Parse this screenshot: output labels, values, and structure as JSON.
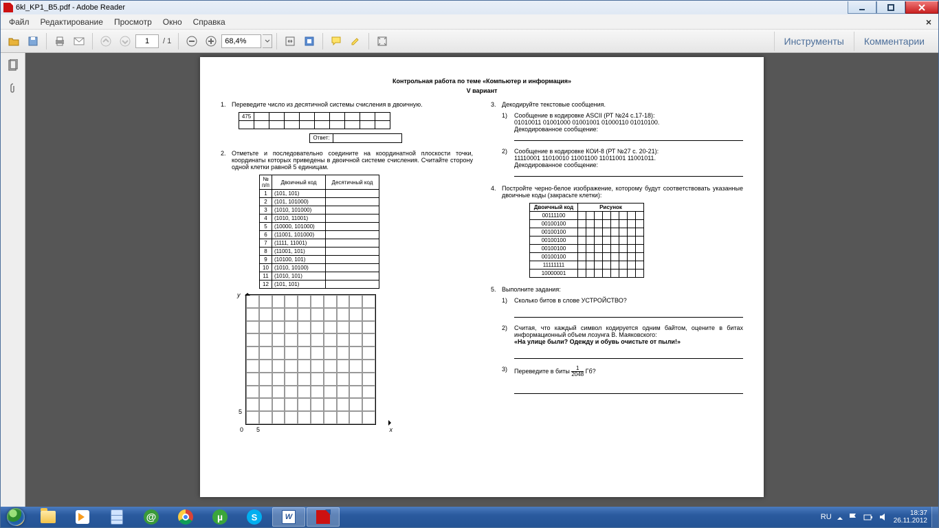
{
  "window": {
    "title": "6kl_KP1_B5.pdf - Adobe Reader"
  },
  "menu": {
    "file": "Файл",
    "edit": "Редактирование",
    "view": "Просмотр",
    "window": "Окно",
    "help": "Справка"
  },
  "toolbar": {
    "page_current": "1",
    "page_total": "/ 1",
    "zoom": "68,4%",
    "tools": "Инструменты",
    "comments": "Комментарии"
  },
  "doc": {
    "title": "Контрольная работа по теме «Компьютер и информация»",
    "subtitle": "V вариант",
    "q1": {
      "num": "1.",
      "text": "Переведите число из десятичной системы счисления в двоичную.",
      "value": "475",
      "answer_label": "Ответ:"
    },
    "q2": {
      "num": "2.",
      "text": "Отметьте и последовательно соедините на координатной плоскости точки, координаты которых приведены в двоичной системе счисления. Считайте сторону одной клетки равной 5 единицам.",
      "head_n": "№ п/п",
      "head_bin": "Двоичный код",
      "head_dec": "Десятичный код",
      "rows": [
        {
          "n": "1",
          "b": "(101, 101)"
        },
        {
          "n": "2",
          "b": "(101, 101000)"
        },
        {
          "n": "3",
          "b": "(1010, 101000)"
        },
        {
          "n": "4",
          "b": "(1010, 11001)"
        },
        {
          "n": "5",
          "b": "(10000, 101000)"
        },
        {
          "n": "6",
          "b": "(11001, 101000)"
        },
        {
          "n": "7",
          "b": "(1111, 11001)"
        },
        {
          "n": "8",
          "b": "(11001, 101)"
        },
        {
          "n": "9",
          "b": "(10100, 101)"
        },
        {
          "n": "10",
          "b": "(1010, 10100)"
        },
        {
          "n": "11",
          "b": "(1010, 101)"
        },
        {
          "n": "12",
          "b": "(101, 101)"
        }
      ],
      "axis": {
        "y": "y",
        "x": "x",
        "zero": "0",
        "five": "5"
      }
    },
    "q3": {
      "num": "3.",
      "text": "Декодируйте текстовые сообщения.",
      "s1_num": "1)",
      "s1": "Сообщение в кодировке ASCII (РТ №24 с.17-18):",
      "s1_code": "01010011 01001000 01001001 01000110 01010100.",
      "s1_lab": "Декодированное сообщение:",
      "s2_num": "2)",
      "s2": "Сообщение в кодировке КОИ-8 (РТ №27 с. 20-21):",
      "s2_code": "11110001 11010010 11001100 11011001 11001011.",
      "s2_lab": "Декодированное сообщение:"
    },
    "q4": {
      "num": "4.",
      "text": "Постройте черно-белое изображение, которому будут соответствовать указанные двоичные коды (закрасьте клетки):",
      "h_bin": "Двоичный код",
      "h_pic": "Рисунок",
      "codes": [
        "00111100",
        "00100100",
        "00100100",
        "00100100",
        "00100100",
        "00100100",
        "11111111",
        "10000001"
      ]
    },
    "q5": {
      "num": "5.",
      "text": "Выполните задания:",
      "s1_num": "1)",
      "s1": "Сколько битов в слове УСТРОЙСТВО?",
      "s2_num": "2)",
      "s2": "Считая, что каждый символ кодируется одним байтом, оцените в битах информационный объем лозунга В. Маяковского:",
      "s2_bold": "«На улице были? Одежду и обувь очистьте от пыли!»",
      "s3_num": "3)",
      "s3_a": "Переведите в биты ",
      "s3_top": "1",
      "s3_bot": "2048",
      "s3_b": " Гб?"
    }
  },
  "tray": {
    "lang": "RU",
    "time": "18:37",
    "date": "26.11.2012"
  }
}
